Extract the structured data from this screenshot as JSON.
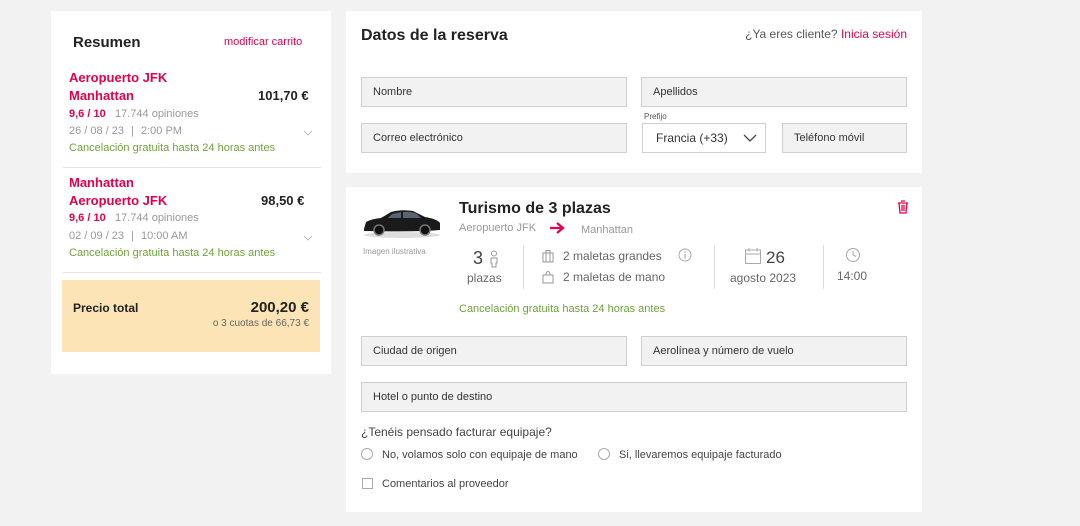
{
  "summary": {
    "title": "Resumen",
    "modify_link": "modificar carrito",
    "items": [
      {
        "route_from": "Aeropuerto JFK",
        "route_to": "Manhattan",
        "price": "101,70 €",
        "rating": "9,6 / 10",
        "reviews": "17.744 opiniones",
        "date": "26 / 08 / 23",
        "sep": "|",
        "time": "2:00 PM",
        "cancel": "Cancelación gratuita hasta 24 horas antes"
      },
      {
        "route_from": "Manhattan",
        "route_to": "Aeropuerto JFK",
        "price": "98,50 €",
        "rating": "9,6 / 10",
        "reviews": "17.744 opiniones",
        "date": "02 / 09 / 23",
        "sep": "|",
        "time": "10:00 AM",
        "cancel": "Cancelación gratuita hasta 24 horas antes"
      }
    ],
    "total_label": "Precio total",
    "total_value": "200,20 €",
    "installments": "o 3 cuotas de 66,73 €"
  },
  "reservation": {
    "title": "Datos de la reserva",
    "client_question": "¿Ya eres cliente?",
    "login_link": "Inicia sesión",
    "name_placeholder": "Nombre",
    "surname_placeholder": "Apellidos",
    "email_placeholder": "Correo electrónico",
    "prefix_label": "Prefijo",
    "prefix_value": "Francia (+33)",
    "phone_placeholder": "Teléfono móvil"
  },
  "vehicle": {
    "title": "Turismo de 3 plazas",
    "image_caption": "Imagen ilustrativa",
    "from": "Aeropuerto JFK",
    "to": "Manhattan",
    "seats_number": "3",
    "seats_label": "plazas",
    "luggage_big": "2 maletas grandes",
    "luggage_hand": "2 maletas de mano",
    "day": "26",
    "month_year": "agosto 2023",
    "time": "14:00",
    "cancel": "Cancelación gratuita hasta 24 horas antes",
    "origin_city_placeholder": "Ciudad de origen",
    "flight_placeholder": "Aerolínea y número de vuelo",
    "destination_placeholder": "Hotel o punto de destino",
    "luggage_question": "¿Tenéis pensado facturar equipaje?",
    "option_no": "No, volamos solo con equipaje de mano",
    "option_yes": "Si, llevaremos equipaje facturado",
    "comments_label": "Comentarios al proveedor"
  },
  "colors": {
    "accent": "#e6004c",
    "green": "#6ea33a",
    "total_bg": "#fce4b6"
  }
}
